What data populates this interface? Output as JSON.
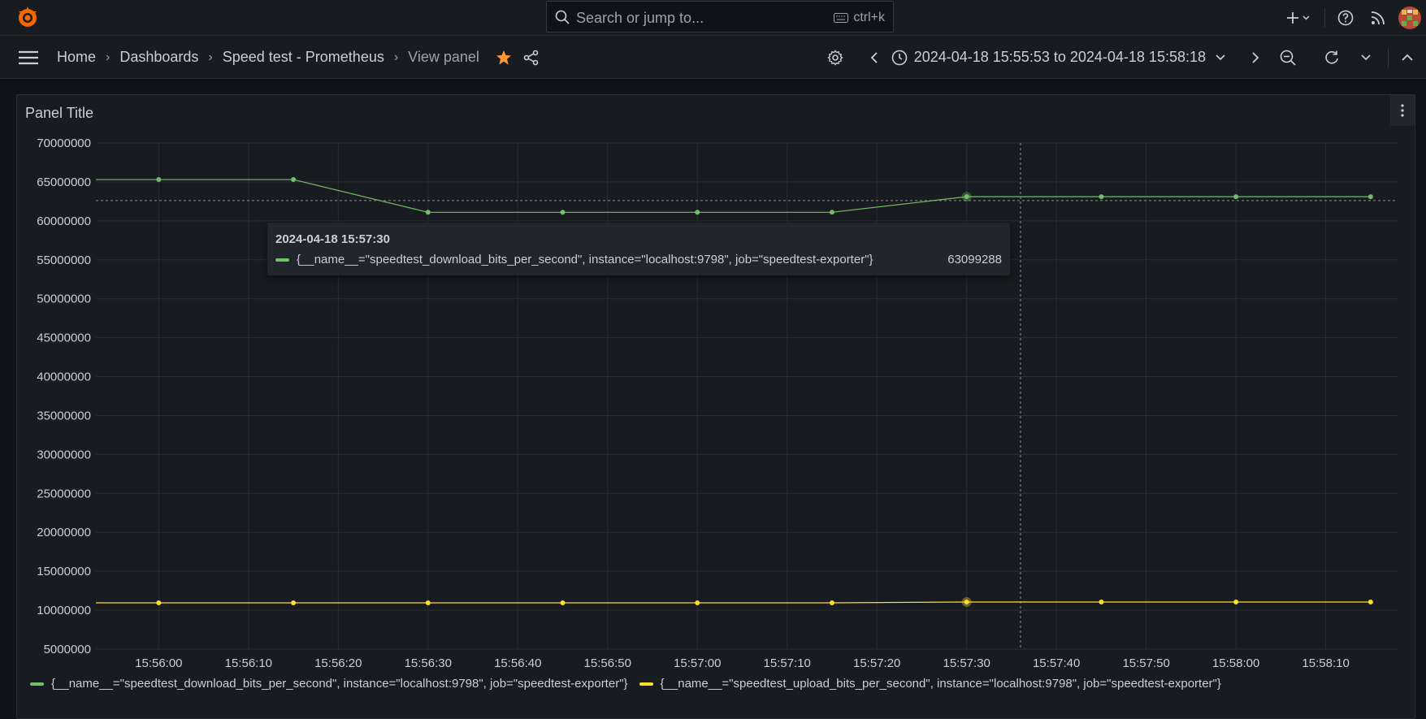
{
  "search": {
    "placeholder": "Search or jump to...",
    "shortcut": "ctrl+k"
  },
  "breadcrumb": {
    "home": "Home",
    "dashboards": "Dashboards",
    "dashboard": "Speed test - Prometheus",
    "current": "View panel"
  },
  "time_picker": {
    "range": "2024-04-18 15:55:53 to 2024-04-18 15:58:18"
  },
  "panel": {
    "title": "Panel Title"
  },
  "colors": {
    "download": "#73bf69",
    "upload": "#fade2a",
    "accent_star": "#ff9830"
  },
  "tooltip": {
    "time": "2024-04-18 15:57:30",
    "series": "{__name__=\"speedtest_download_bits_per_second\", instance=\"localhost:9798\", job=\"speedtest-exporter\"}",
    "value": "63099288"
  },
  "chart_data": {
    "type": "line",
    "x": [
      "15:56:00",
      "15:56:15",
      "15:56:30",
      "15:56:45",
      "15:57:00",
      "15:57:15",
      "15:57:30",
      "15:57:45",
      "15:58:00",
      "15:58:15"
    ],
    "x_ticks": [
      "15:56:00",
      "15:56:10",
      "15:56:20",
      "15:56:30",
      "15:56:40",
      "15:56:50",
      "15:57:00",
      "15:57:10",
      "15:57:20",
      "15:57:30",
      "15:57:40",
      "15:57:50",
      "15:58:00",
      "15:58:10"
    ],
    "y_ticks": [
      "5000000",
      "10000000",
      "15000000",
      "20000000",
      "25000000",
      "30000000",
      "35000000",
      "40000000",
      "45000000",
      "50000000",
      "55000000",
      "60000000",
      "65000000",
      "70000000"
    ],
    "ylim": [
      5000000,
      70000000
    ],
    "xlim": [
      "15:55:53",
      "15:58:18"
    ],
    "grid": true,
    "legend_position": "bottom",
    "series": [
      {
        "name": "{__name__=\"speedtest_download_bits_per_second\", instance=\"localhost:9798\", job=\"speedtest-exporter\"}",
        "color": "#73bf69",
        "values": [
          65300000,
          65300000,
          61100000,
          61100000,
          61100000,
          61100000,
          63099288,
          63100000,
          63100000,
          63100000
        ]
      },
      {
        "name": "{__name__=\"speedtest_upload_bits_per_second\", instance=\"localhost:9798\", job=\"speedtest-exporter\"}",
        "color": "#fade2a",
        "values": [
          10950000,
          10950000,
          10950000,
          10950000,
          10950000,
          10950000,
          11050000,
          11050000,
          11050000,
          11050000
        ]
      }
    ],
    "hover": {
      "x": "15:57:30",
      "cursor_x": "15:57:36",
      "cursor_y": 62600000
    }
  }
}
